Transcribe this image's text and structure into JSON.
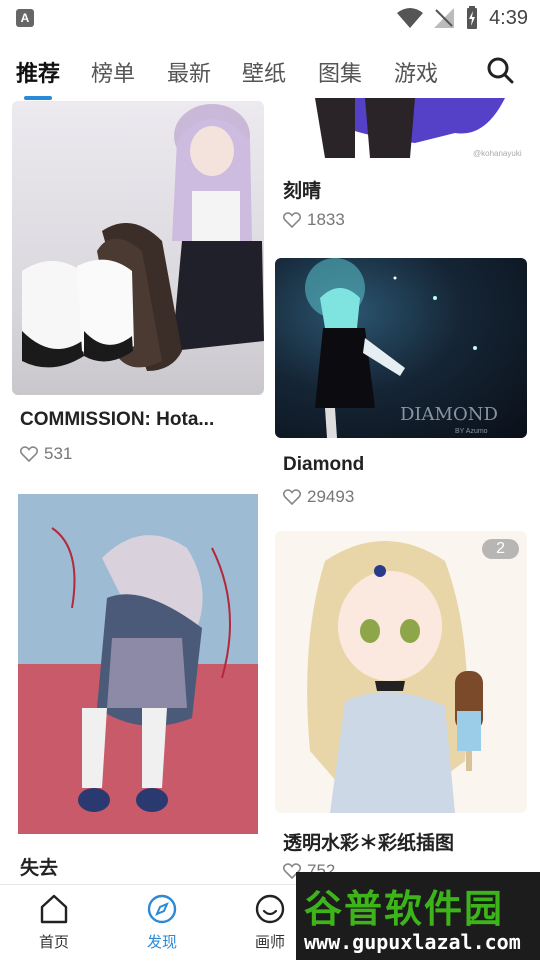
{
  "status_bar": {
    "app_icon_letter": "A",
    "time": "4:39"
  },
  "tabs": [
    {
      "label": "推荐",
      "active": true
    },
    {
      "label": "榜单",
      "active": false
    },
    {
      "label": "最新",
      "active": false
    },
    {
      "label": "壁纸",
      "active": false
    },
    {
      "label": "图集",
      "active": false
    },
    {
      "label": "游戏",
      "active": false
    }
  ],
  "feed": {
    "left": [
      {
        "title": "COMMISSION: Hota...",
        "likes": "531"
      },
      {
        "title": "失去",
        "likes": ""
      }
    ],
    "right": [
      {
        "title": "刻晴",
        "likes": "1833",
        "watermark_text": "@kohanayuki"
      },
      {
        "title": "Diamond",
        "likes": "29493",
        "image_text": "DIAMOND",
        "image_subtext": "BY Azumo"
      },
      {
        "title": "透明水彩＊彩纸插图",
        "likes": "752",
        "badge": "2"
      }
    ]
  },
  "bottom_nav": [
    {
      "label": "首页",
      "icon": "home-icon",
      "active": false
    },
    {
      "label": "发现",
      "icon": "compass-icon",
      "active": true
    },
    {
      "label": "画师",
      "icon": "smile-icon",
      "active": false
    }
  ],
  "site_watermark": {
    "title": "谷普软件园",
    "url": "www.gupuxlazal.com"
  },
  "colors": {
    "accent": "#2a8ad8",
    "text_primary": "#222222",
    "text_secondary": "#777777"
  }
}
